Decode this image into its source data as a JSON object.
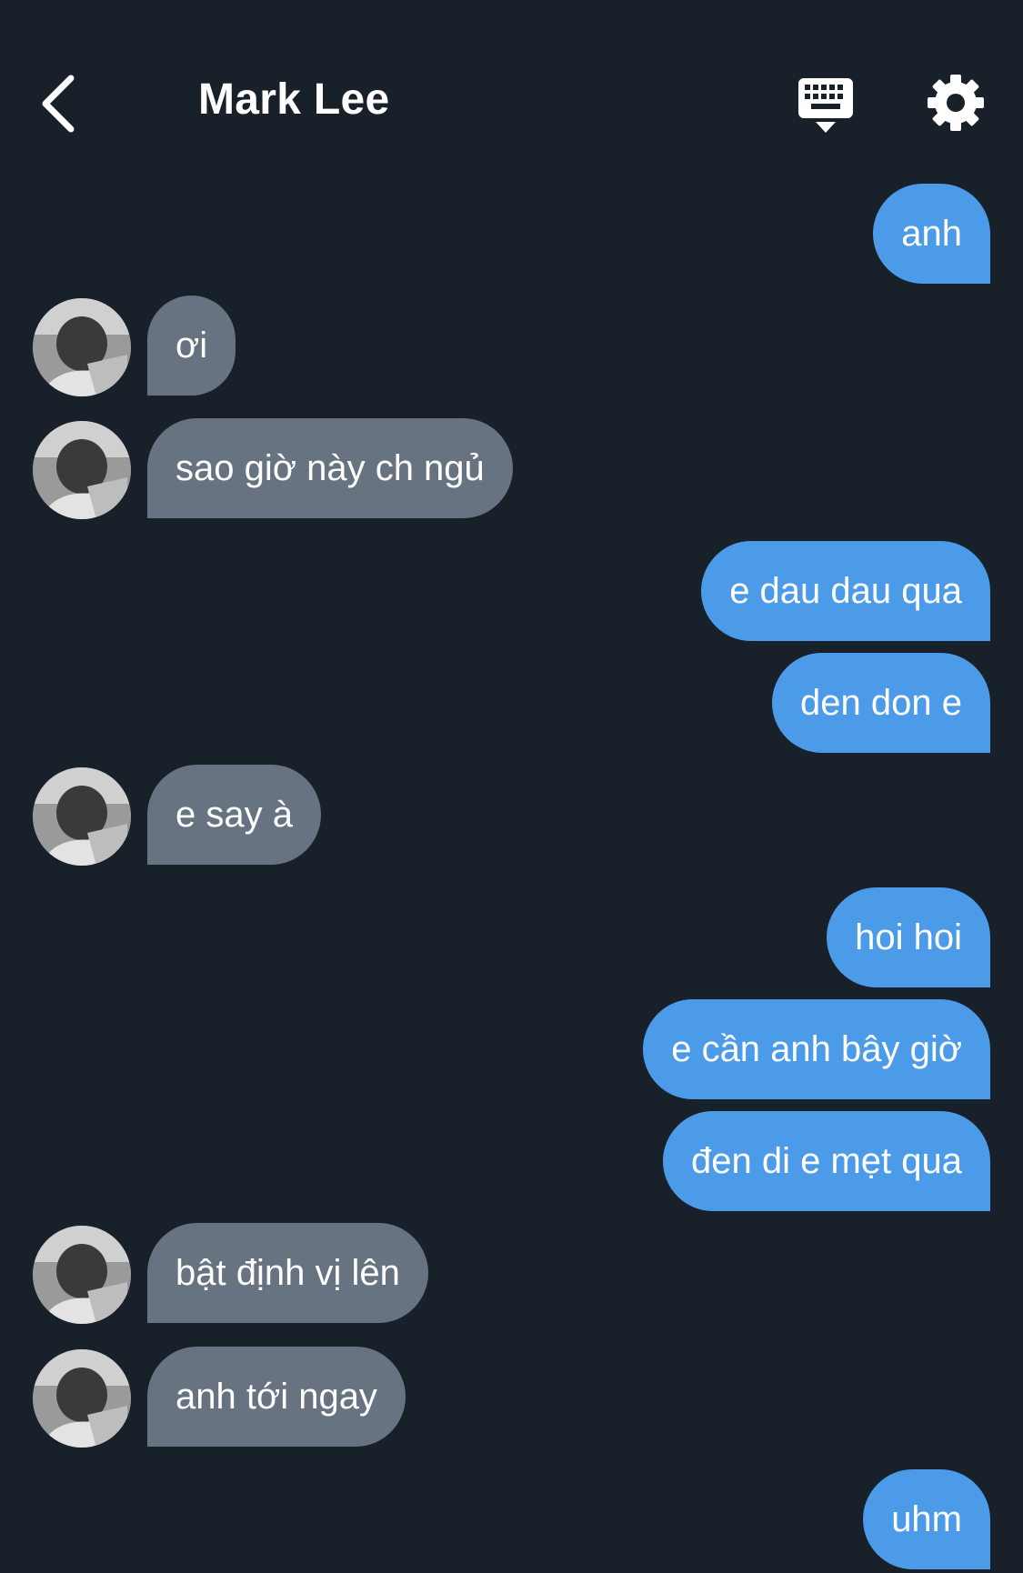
{
  "header": {
    "title": "Mark Lee",
    "back_icon": "chevron-left-icon",
    "keyboard_icon": "keyboard-icon",
    "settings_icon": "gear-icon"
  },
  "colors": {
    "background": "#182029",
    "sent_bubble": "#4c9be8",
    "received_bubble": "#677380",
    "text": "#ffffff"
  },
  "messages": [
    {
      "side": "sent",
      "text": "anh"
    },
    {
      "side": "received",
      "text": "ơi"
    },
    {
      "side": "received",
      "text": "sao giờ này ch ngủ"
    },
    {
      "side": "sent",
      "text": "e dau dau qua"
    },
    {
      "side": "sent",
      "text": "den don e"
    },
    {
      "side": "received",
      "text": "e say à"
    },
    {
      "side": "sent",
      "text": "hoi hoi"
    },
    {
      "side": "sent",
      "text": "e cần anh bây giờ"
    },
    {
      "side": "sent",
      "text": "đen di e mẹt qua"
    },
    {
      "side": "received",
      "text": "bật định vị lên"
    },
    {
      "side": "received",
      "text": "anh tới ngay"
    },
    {
      "side": "sent",
      "text": "uhm"
    }
  ]
}
